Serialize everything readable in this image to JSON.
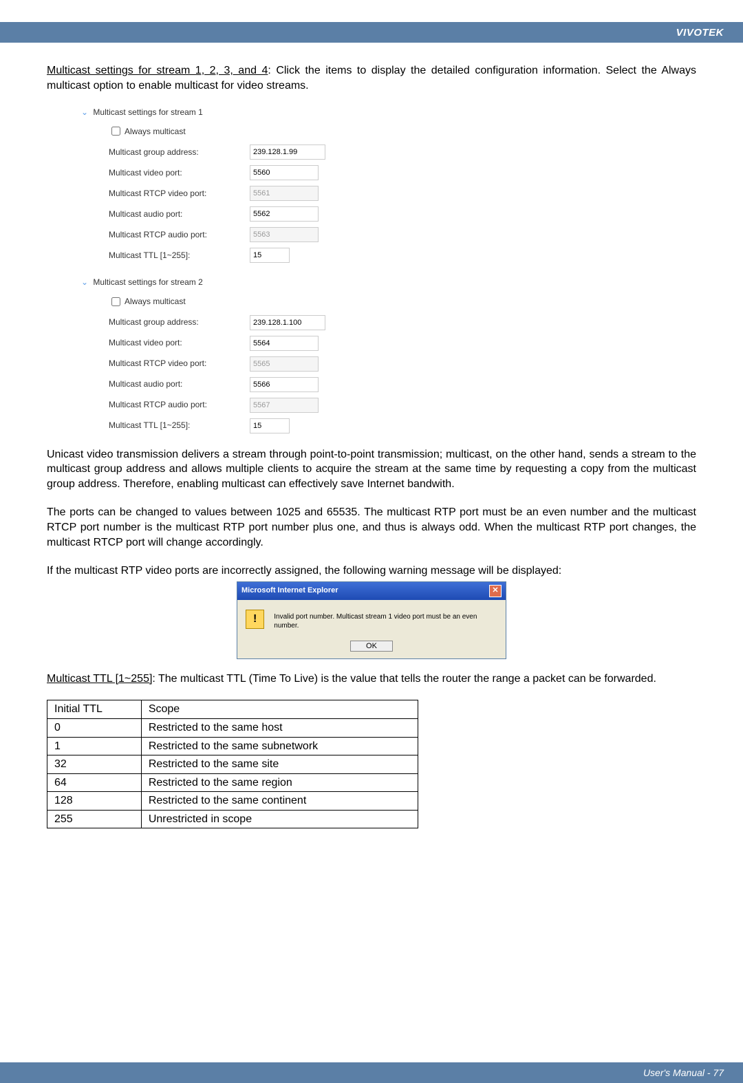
{
  "header": {
    "brand": "VIVOTEK"
  },
  "intro": {
    "span": "Multicast settings for stream 1, 2, 3, and 4",
    "rest": ": Click the items to display the detailed configuration information. Select the Always multicast option to enable multicast for video streams."
  },
  "form": {
    "stream1": {
      "title": "Multicast settings for stream 1",
      "always": "Always multicast",
      "fields": [
        {
          "label": "Multicast group address:",
          "value": "239.128.1.99",
          "wide": true,
          "disabled": false
        },
        {
          "label": "Multicast video port:",
          "value": "5560",
          "wide": false,
          "disabled": false
        },
        {
          "label": "Multicast RTCP video port:",
          "value": "5561",
          "wide": false,
          "disabled": true
        },
        {
          "label": "Multicast audio port:",
          "value": "5562",
          "wide": false,
          "disabled": false
        },
        {
          "label": "Multicast RTCP audio port:",
          "value": "5563",
          "wide": false,
          "disabled": true
        },
        {
          "label": "Multicast TTL [1~255]:",
          "value": "15",
          "narrow": true,
          "disabled": false
        }
      ]
    },
    "stream2": {
      "title": "Multicast settings for stream 2",
      "always": "Always multicast",
      "fields": [
        {
          "label": "Multicast group address:",
          "value": "239.128.1.100",
          "wide": true,
          "disabled": false
        },
        {
          "label": "Multicast video port:",
          "value": "5564",
          "wide": false,
          "disabled": false
        },
        {
          "label": "Multicast RTCP video port:",
          "value": "5565",
          "wide": false,
          "disabled": true
        },
        {
          "label": "Multicast audio port:",
          "value": "5566",
          "wide": false,
          "disabled": false
        },
        {
          "label": "Multicast RTCP audio port:",
          "value": "5567",
          "wide": false,
          "disabled": true
        },
        {
          "label": "Multicast TTL [1~255]:",
          "value": "15",
          "narrow": true,
          "disabled": false
        }
      ]
    }
  },
  "p1": "Unicast video transmission delivers a stream through point-to-point transmission; multicast, on the other hand, sends a stream to the multicast group address and allows multiple clients to acquire the stream at the same time by requesting a copy from the multicast group address. Therefore, enabling multicast can effectively save Internet bandwith.",
  "p2": "The ports can be changed to values between 1025 and 65535. The multicast RTP port must be an even number and the multicast RTCP port number is the multicast RTP port number plus one, and thus is always odd. When the multicast RTP port changes, the multicast RTCP port will change accordingly.",
  "p3": "If the multicast RTP video ports are incorrectly assigned, the following warning message will be displayed:",
  "dialog": {
    "title": "Microsoft Internet Explorer",
    "text": "Invalid port number. Multicast stream 1 video port must be an even number.",
    "ok": "OK"
  },
  "ttlpara": {
    "span": "Multicast TTL [1~255]",
    "rest": ": The multicast TTL (Time To Live) is the value that tells the router the range a packet can be forwarded."
  },
  "table": {
    "h1": "Initial TTL",
    "h2": "Scope",
    "rows": [
      {
        "ttl": "0",
        "scope": "Restricted to the same host"
      },
      {
        "ttl": "1",
        "scope": "Restricted to the same subnetwork"
      },
      {
        "ttl": "32",
        "scope": "Restricted to the same site"
      },
      {
        "ttl": "64",
        "scope": "Restricted to the same region"
      },
      {
        "ttl": "128",
        "scope": "Restricted to the same continent"
      },
      {
        "ttl": "255",
        "scope": "Unrestricted in scope"
      }
    ]
  },
  "footer": {
    "text": "User's Manual - 77"
  }
}
